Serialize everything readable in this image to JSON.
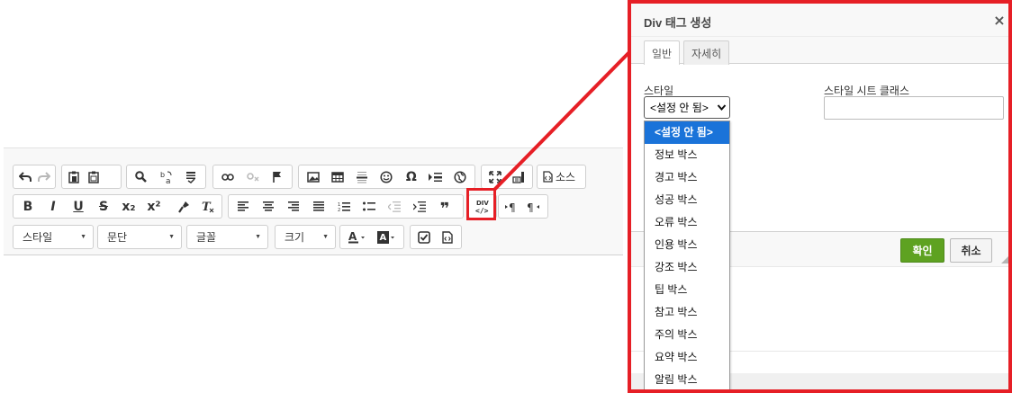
{
  "editor": {
    "toolbar_row1": {
      "history": [
        "undo-icon",
        "redo-icon"
      ],
      "clipboard": [
        "paste-icon",
        "paste-word-icon",
        "paste-text-icon"
      ],
      "find": [
        "find-icon",
        "replace-icon",
        "spellcheck-icon"
      ],
      "links": [
        "link-icon",
        "unlink-icon",
        "anchor-icon"
      ],
      "insert": [
        "image-icon",
        "table-icon",
        "horizontal-line-icon",
        "smiley-icon",
        "special-char-icon",
        "page-break-icon",
        "iframe-icon"
      ],
      "view": [
        "maximize-icon",
        "show-blocks-icon"
      ],
      "source_label": "소스"
    },
    "toolbar_row2": {
      "basic": [
        "B",
        "I",
        "U",
        "S",
        "x₂",
        "x²"
      ],
      "format": [
        "copy-format-icon",
        "remove-format-icon"
      ],
      "paragraph": [
        "align-left-icon",
        "align-center-icon",
        "align-right-icon",
        "align-justify-icon",
        "numbered-list-icon",
        "bulleted-list-icon",
        "outdent-icon",
        "indent-icon",
        "blockquote-icon",
        "create-div-icon"
      ],
      "bidi": [
        "ltr-icon",
        "rtl-icon"
      ]
    },
    "toolbar_row3": {
      "combos": [
        {
          "label": "스타일"
        },
        {
          "label": "문단"
        },
        {
          "label": "글꼴"
        },
        {
          "label": "크기"
        }
      ],
      "colors": [
        "text-color-icon",
        "bg-color-icon"
      ],
      "extras": [
        "checkbox-icon",
        "html-file-icon"
      ],
      "div_label": "DIV"
    }
  },
  "dialog": {
    "title": "Div 태그 생성",
    "close": "×",
    "tabs": [
      {
        "label": "일반",
        "active": true
      },
      {
        "label": "자세히",
        "active": false
      }
    ],
    "style_label": "스타일",
    "style_value": "<설정 안 됨>",
    "stylesheet_label": "스타일 시트 클래스",
    "stylesheet_value": "",
    "ok_label": "확인",
    "cancel_label": "취소",
    "style_options": [
      "<설정 안 됨>",
      "정보 박스",
      "경고 박스",
      "성공 박스",
      "오류 박스",
      "인용 박스",
      "강조 박스",
      "팁 박스",
      "참고 박스",
      "주의 박스",
      "요약 박스",
      "알림 박스"
    ],
    "selected_option_index": 0
  },
  "colors": {
    "highlight": "#e61f26",
    "ok_button": "#5ea221",
    "dropdown_selected": "#1a73d9"
  }
}
